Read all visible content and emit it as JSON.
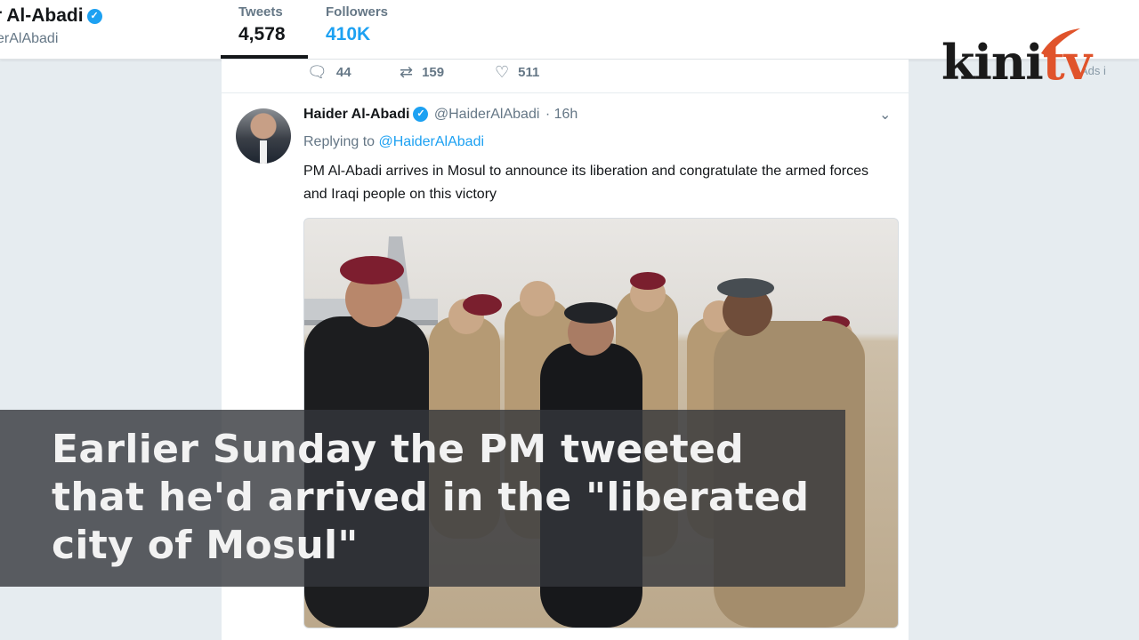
{
  "header": {
    "name": "r Al-Abadi",
    "handle": "erAlAbadi",
    "stats": [
      {
        "label": "Tweets",
        "value": "4,578"
      },
      {
        "label": "Followers",
        "value": "410K"
      }
    ]
  },
  "prev_tweet_actions": {
    "replies": "44",
    "retweets": "159",
    "likes": "511"
  },
  "tweet": {
    "author_name": "Haider Al-Abadi",
    "author_handle": "@HaiderAlAbadi",
    "time": "· 16h",
    "replying_prefix": "Replying to",
    "replying_to": "@HaiderAlAbadi",
    "text": "PM Al-Abadi arrives in Mosul to announce its liberation and congratulate the armed forces and Iraqi people on this victory"
  },
  "caption": "Earlier Sunday the PM tweeted that he'd arrived in the \"liberated city of Mosul\"",
  "sidebar": {
    "ads_text": "Ads i"
  },
  "logo": {
    "part1": "kini",
    "part2": "tv"
  },
  "icons": {
    "reply": "reply-icon",
    "retweet": "retweet-icon",
    "like": "heart-icon",
    "verified": "verified-badge-icon",
    "caret": "chevron-down-icon"
  },
  "colors": {
    "accent": "#1da1f2",
    "text": "#14171a",
    "muted": "#657786",
    "logo_orange": "#e0532b"
  }
}
